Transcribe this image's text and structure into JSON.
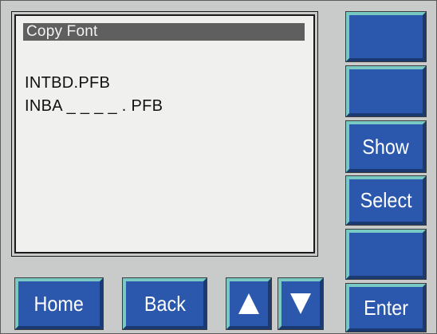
{
  "screen": {
    "title": "Copy Font",
    "lines": [
      "INTBD.PFB",
      "INBA _ _ _ _ . PFB"
    ]
  },
  "side_buttons": [
    {
      "label": ""
    },
    {
      "label": ""
    },
    {
      "label": "Show"
    },
    {
      "label": "Select"
    },
    {
      "label": ""
    },
    {
      "label": "Enter"
    }
  ],
  "bottom_buttons": {
    "home": "Home",
    "back": "Back",
    "up_icon": "up-arrow-icon",
    "down_icon": "down-arrow-icon"
  },
  "colors": {
    "button_face": "#2b57ad",
    "button_highlight": "#78c9c3",
    "panel": "#c9cbcb",
    "screen": "#f0f0ef",
    "title_bar": "#5f5f5f"
  }
}
